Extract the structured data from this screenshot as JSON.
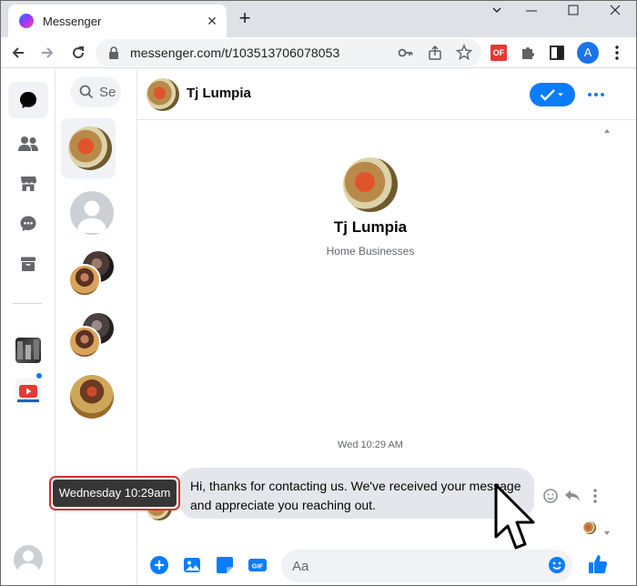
{
  "browser": {
    "tab_title": "Messenger",
    "tab_close": "✕",
    "new_tab": "+",
    "url": "messenger.com/t/103513706078053",
    "extension_badge": "OF",
    "profile_initial": "A"
  },
  "nav": {
    "items": [
      "chats",
      "people",
      "marketplace",
      "requests",
      "archive"
    ],
    "active": "chats"
  },
  "chat_list": {
    "search_placeholder": "Se"
  },
  "thread": {
    "contact_name": "Tj Lumpia",
    "profile_name": "Tj Lumpia",
    "profile_subtitle": "Home Businesses",
    "timestamp": "Wed 10:29 AM",
    "message_text": "Hi, thanks for contacting us. We've received your message and appreciate you reaching out.",
    "composer_placeholder": "Aa",
    "tooltip": "Wednesday 10:29am"
  },
  "colors": {
    "accent": "#0a7cff",
    "tooltip_border": "#d32f2f",
    "tooltip_bg": "#363636",
    "bubble_bg": "#e4e6eb"
  }
}
